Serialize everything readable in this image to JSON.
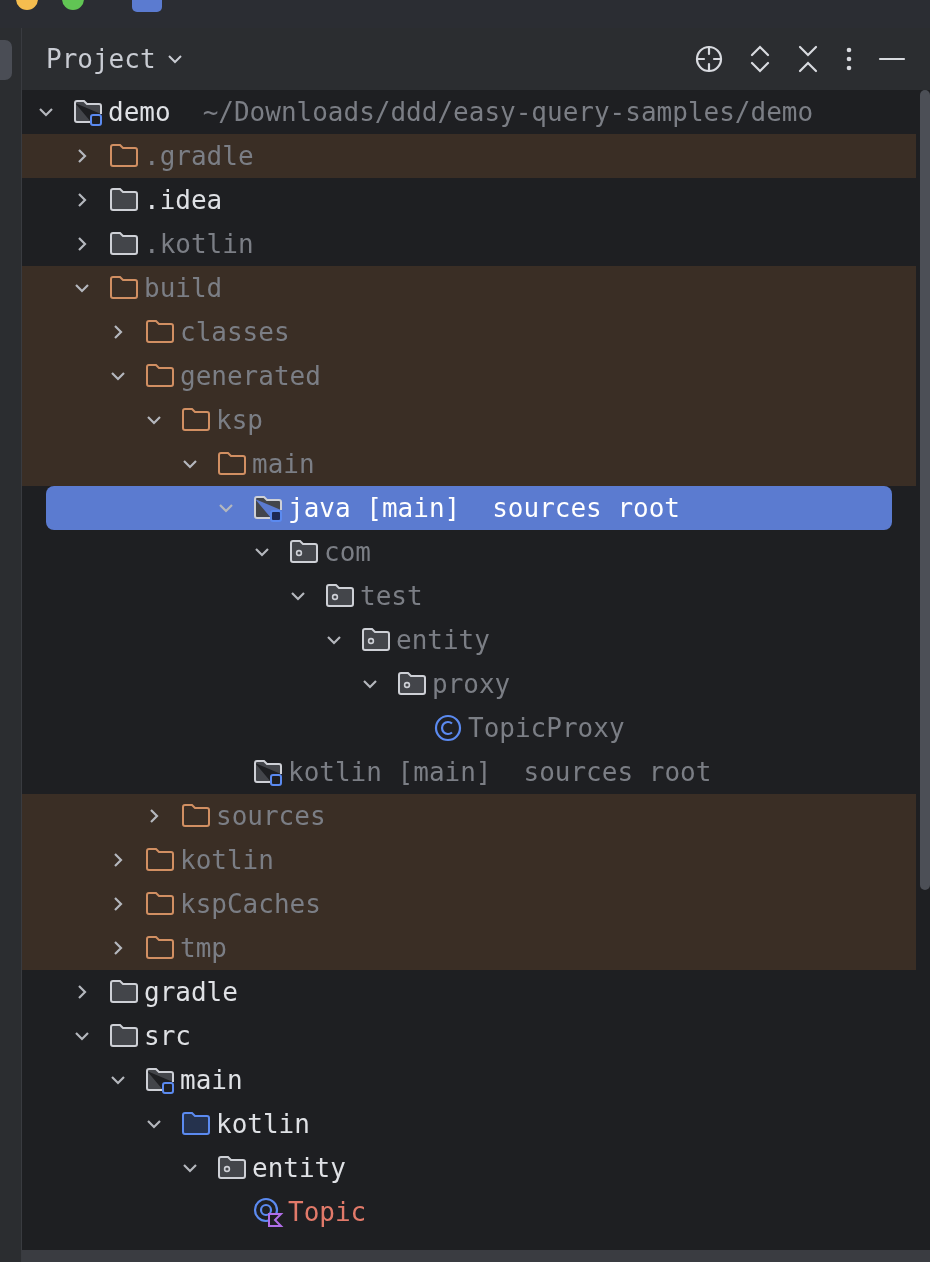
{
  "panel": {
    "title": "Project"
  },
  "tree": [
    {
      "label": "demo",
      "suffix": "~/Downloads/ddd/easy-query-samples/demo",
      "kind": "module",
      "dimmed": false,
      "expanded": true,
      "selected": false,
      "children": [
        {
          "label": ".gradle",
          "kind": "excluded-folder",
          "dimmed": true,
          "expanded": false,
          "selected": false
        },
        {
          "label": ".idea",
          "kind": "folder",
          "dimmed": false,
          "expanded": false,
          "selected": false
        },
        {
          "label": ".kotlin",
          "kind": "folder",
          "dimmed": true,
          "expanded": false,
          "selected": false
        },
        {
          "label": "build",
          "kind": "excluded-folder",
          "dimmed": true,
          "expanded": true,
          "selected": false,
          "children": [
            {
              "label": "classes",
              "kind": "excluded-folder",
              "dimmed": true,
              "expanded": false,
              "selected": false
            },
            {
              "label": "generated",
              "kind": "excluded-folder",
              "dimmed": true,
              "expanded": true,
              "selected": false,
              "children": [
                {
                  "label": "ksp",
                  "kind": "excluded-folder",
                  "dimmed": true,
                  "expanded": true,
                  "selected": false,
                  "children": [
                    {
                      "label": "main",
                      "kind": "excluded-folder",
                      "dimmed": true,
                      "expanded": true,
                      "selected": false,
                      "children": [
                        {
                          "label": "java [main]",
                          "suffix": "sources root",
                          "kind": "source-root",
                          "dimmed": true,
                          "expanded": true,
                          "selected": true,
                          "children": [
                            {
                              "label": "com",
                              "kind": "package",
                              "dimmed": true,
                              "expanded": true,
                              "selected": false,
                              "children": [
                                {
                                  "label": "test",
                                  "kind": "package",
                                  "dimmed": true,
                                  "expanded": true,
                                  "selected": false,
                                  "children": [
                                    {
                                      "label": "entity",
                                      "kind": "package",
                                      "dimmed": true,
                                      "expanded": true,
                                      "selected": false,
                                      "children": [
                                        {
                                          "label": "proxy",
                                          "kind": "package",
                                          "dimmed": true,
                                          "expanded": true,
                                          "selected": false,
                                          "children": [
                                            {
                                              "label": "TopicProxy",
                                              "kind": "class",
                                              "dimmed": true,
                                              "selected": false
                                            }
                                          ]
                                        }
                                      ]
                                    }
                                  ]
                                }
                              ]
                            }
                          ]
                        },
                        {
                          "label": "kotlin [main]",
                          "suffix": "sources root",
                          "kind": "source-root",
                          "dimmed": true,
                          "selected": false
                        }
                      ]
                    }
                  ]
                },
                {
                  "label": "sources",
                  "kind": "excluded-folder",
                  "dimmed": true,
                  "expanded": false,
                  "selected": false
                }
              ]
            },
            {
              "label": "kotlin",
              "kind": "excluded-folder",
              "dimmed": true,
              "expanded": false,
              "selected": false
            },
            {
              "label": "kspCaches",
              "kind": "excluded-folder",
              "dimmed": true,
              "expanded": false,
              "selected": false
            },
            {
              "label": "tmp",
              "kind": "excluded-folder",
              "dimmed": true,
              "expanded": false,
              "selected": false
            }
          ]
        },
        {
          "label": "gradle",
          "kind": "folder",
          "dimmed": false,
          "expanded": false,
          "selected": false
        },
        {
          "label": "src",
          "kind": "folder",
          "dimmed": false,
          "expanded": true,
          "selected": false,
          "children": [
            {
              "label": "main",
              "kind": "module",
              "dimmed": false,
              "expanded": true,
              "selected": false,
              "children": [
                {
                  "label": "kotlin",
                  "kind": "source-folder",
                  "dimmed": false,
                  "expanded": true,
                  "selected": false,
                  "children": [
                    {
                      "label": "entity",
                      "kind": "package",
                      "dimmed": false,
                      "expanded": true,
                      "selected": false,
                      "children": [
                        {
                          "label": "Topic",
                          "kind": "kotlin-class",
                          "unversioned": true,
                          "selected": false
                        }
                      ]
                    }
                  ]
                }
              ]
            }
          ]
        }
      ]
    }
  ]
}
